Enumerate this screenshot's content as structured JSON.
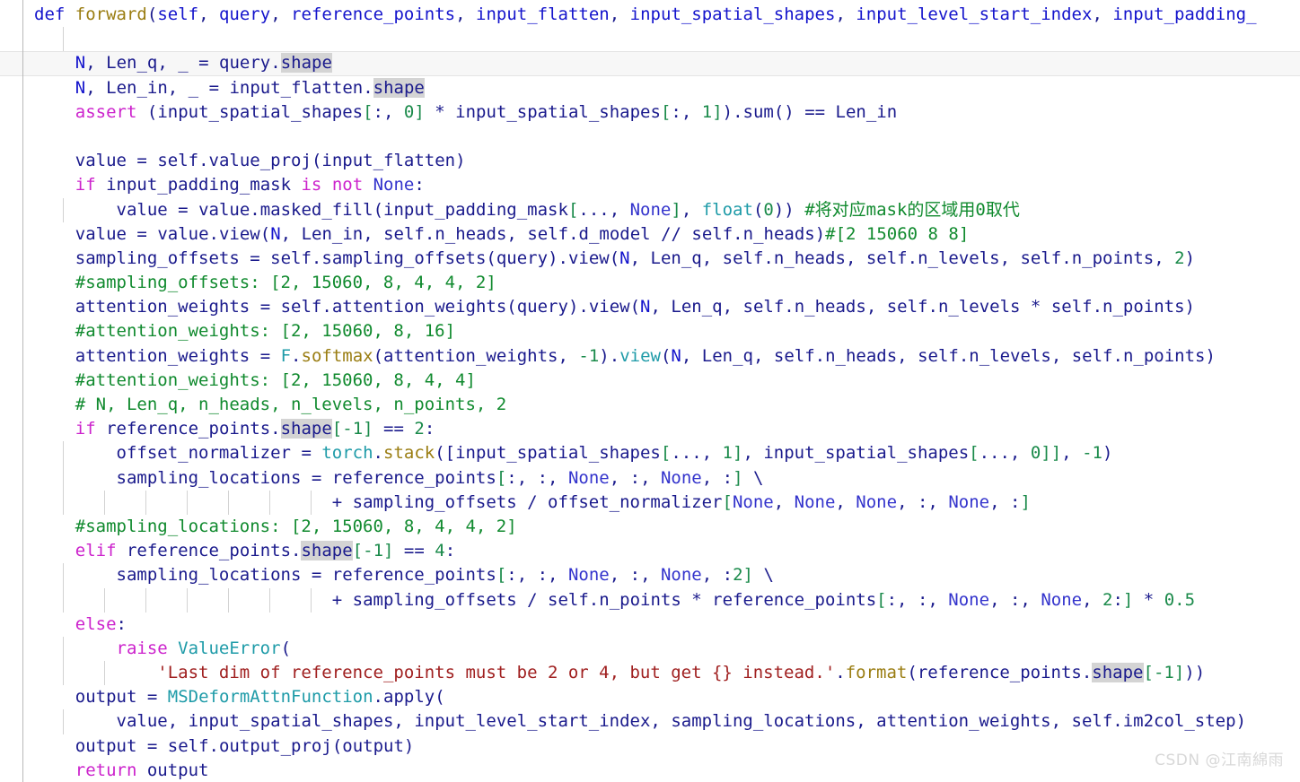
{
  "editor": {
    "language": "python",
    "theme": "light",
    "font_size_px": 19,
    "colors": {
      "background": "#ffffff",
      "keyword": "#cc22cc",
      "def_keyword": "#1414cc",
      "function_name": "#9a7d12",
      "class_name": "#1e9ba8",
      "identifier": "#1a1a8c",
      "parameter": "#1414cc",
      "number": "#1a8a4a",
      "comment": "#108a2e",
      "string": "#a02020",
      "none_literal": "#3333cc",
      "occurrence_highlight": "#d4d4d4",
      "current_line": "#f7f7f7",
      "indent_guide": "#d2d2d2",
      "gutter_rule": "#b9b9b9",
      "watermark": "#d8d8d8"
    },
    "current_line_number": 3,
    "highlighted_token": "shape"
  },
  "watermark": {
    "text": "CSDN @江南綿雨"
  },
  "code": {
    "lines": [
      "def forward(self, query, reference_points, input_flatten, input_spatial_shapes, input_level_start_index, input_padding_",
      "",
      "    N, Len_q, _ = query.shape",
      "    N, Len_in, _ = input_flatten.shape",
      "    assert (input_spatial_shapes[:, 0] * input_spatial_shapes[:, 1]).sum() == Len_in",
      "",
      "    value = self.value_proj(input_flatten)",
      "    if input_padding_mask is not None:",
      "        value = value.masked_fill(input_padding_mask[..., None], float(0)) #将对应mask的区域用0取代",
      "    value = value.view(N, Len_in, self.n_heads, self.d_model // self.n_heads)#[2 15060 8 8]",
      "    sampling_offsets = self.sampling_offsets(query).view(N, Len_q, self.n_heads, self.n_levels, self.n_points, 2)",
      "    #sampling_offsets: [2, 15060, 8, 4, 4, 2]",
      "    attention_weights = self.attention_weights(query).view(N, Len_q, self.n_heads, self.n_levels * self.n_points)",
      "    #attention_weights: [2, 15060, 8, 16]",
      "    attention_weights = F.softmax(attention_weights, -1).view(N, Len_q, self.n_heads, self.n_levels, self.n_points)",
      "    #attention_weights: [2, 15060, 8, 4, 4]",
      "    # N, Len_q, n_heads, n_levels, n_points, 2",
      "    if reference_points.shape[-1] == 2:",
      "        offset_normalizer = torch.stack([input_spatial_shapes[..., 1], input_spatial_shapes[..., 0]], -1)",
      "        sampling_locations = reference_points[:, :, None, :, None, :] \\",
      "                             + sampling_offsets / offset_normalizer[None, None, None, :, None, :]",
      "    #sampling_locations: [2, 15060, 8, 4, 4, 2]",
      "    elif reference_points.shape[-1] == 4:",
      "        sampling_locations = reference_points[:, :, None, :, None, :2] \\",
      "                             + sampling_offsets / self.n_points * reference_points[:, :, None, :, None, 2:] * 0.5",
      "    else:",
      "        raise ValueError(",
      "            'Last dim of reference_points must be 2 or 4, but get {} instead.'.format(reference_points.shape[-1]))",
      "    output = MSDeformAttnFunction.apply(",
      "        value, input_spatial_shapes, input_level_start_index, sampling_locations, attention_weights, self.im2col_step)",
      "    output = self.output_proj(output)",
      "    return output"
    ],
    "comments": [
      "#将对应mask的区域用0取代",
      "#[2 15060 8 8]",
      "#sampling_offsets: [2, 15060, 8, 4, 4, 2]",
      "#attention_weights: [2, 15060, 8, 16]",
      "#attention_weights: [2, 15060, 8, 4, 4]",
      "# N, Len_q, n_heads, n_levels, n_points, 2",
      "#sampling_locations: [2, 15060, 8, 4, 4, 2]"
    ],
    "strings": [
      "'Last dim of reference_points must be 2 or 4, but get {} instead.'"
    ],
    "function_signature": {
      "name": "forward",
      "params": [
        "self",
        "query",
        "reference_points",
        "input_flatten",
        "input_spatial_shapes",
        "input_level_start_index",
        "input_padding_mask"
      ],
      "truncated": true
    }
  }
}
